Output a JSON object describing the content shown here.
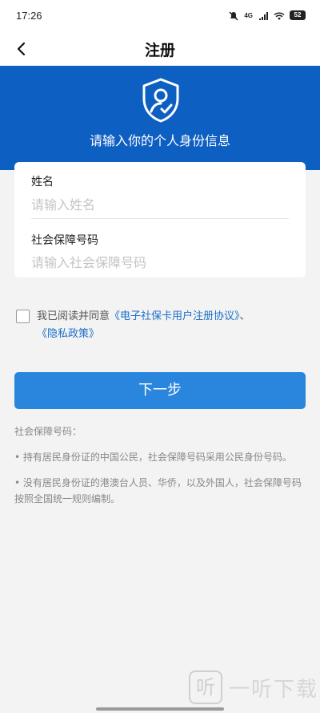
{
  "status_bar": {
    "time": "17:26",
    "network": "4G",
    "battery": "52"
  },
  "nav": {
    "title": "注册"
  },
  "hero": {
    "text": "请输入你的个人身份信息"
  },
  "form": {
    "name_label": "姓名",
    "name_placeholder": "请输入姓名",
    "ssn_label": "社会保障号码",
    "ssn_placeholder": "请输入社会保障号码"
  },
  "agreement": {
    "prefix": "我已阅读并同意",
    "link1": "《电子社保卡用户注册协议》",
    "separator": "、",
    "link2": "《隐私政策》"
  },
  "next_button": "下一步",
  "notes": {
    "title": "社会保障号码：",
    "item1": "• 持有居民身份证的中国公民，社会保障号码采用公民身份号码。",
    "item2": "• 没有居民身份证的港澳台人员、华侨，以及外国人，社会保障号码按照全国统一规则编制。"
  },
  "watermark": {
    "logo": "听",
    "text": "一听下载"
  },
  "colors": {
    "brand_blue": "#0e5fc2",
    "button_blue": "#2a86dd",
    "link_blue": "#1c6fc9",
    "background": "#f3f3f3"
  }
}
